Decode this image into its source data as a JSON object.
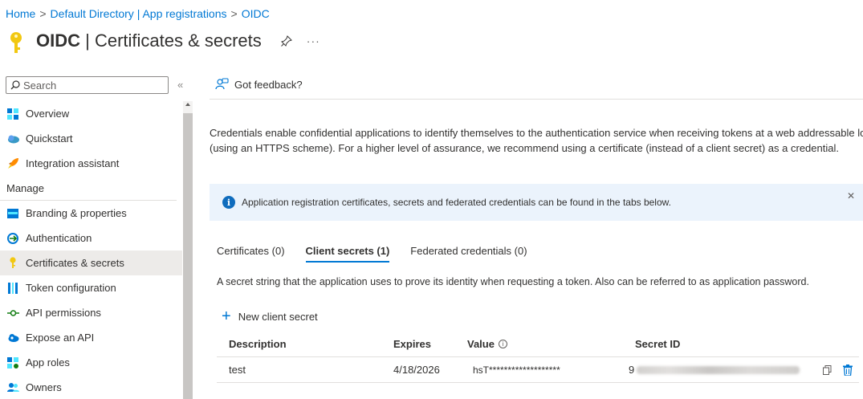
{
  "breadcrumb": {
    "items": [
      "Home",
      "Default Directory | App registrations",
      "OIDC"
    ],
    "separator": ">"
  },
  "page": {
    "title_bold": "OIDC",
    "title_rest": " | Certificates & secrets",
    "more": "···"
  },
  "search": {
    "placeholder": "Search"
  },
  "collapse_label": "«",
  "nav": {
    "items_top": [
      {
        "label": "Overview",
        "icon": "overview-icon"
      },
      {
        "label": "Quickstart",
        "icon": "quickstart-icon"
      },
      {
        "label": "Integration assistant",
        "icon": "rocket-icon"
      }
    ],
    "section": "Manage",
    "items_manage": [
      {
        "label": "Branding & properties",
        "icon": "branding-icon"
      },
      {
        "label": "Authentication",
        "icon": "authentication-icon"
      },
      {
        "label": "Certificates & secrets",
        "icon": "key-icon",
        "active": true
      },
      {
        "label": "Token configuration",
        "icon": "token-icon"
      },
      {
        "label": "API permissions",
        "icon": "api-permissions-icon"
      },
      {
        "label": "Expose an API",
        "icon": "cloud-icon"
      },
      {
        "label": "App roles",
        "icon": "app-roles-icon"
      },
      {
        "label": "Owners",
        "icon": "owners-icon"
      }
    ]
  },
  "feedback": {
    "label": "Got feedback?"
  },
  "description": {
    "line1": "Credentials enable confidential applications to identify themselves to the authentication service when receiving tokens at a web addressable location",
    "line2": "(using an HTTPS scheme). For a higher level of assurance, we recommend using a certificate (instead of a client secret) as a credential."
  },
  "infobar": {
    "text": "Application registration certificates, secrets and federated credentials can be found in the tabs below.",
    "close": "✕"
  },
  "tabs": [
    {
      "label": "Certificates (0)",
      "active": false
    },
    {
      "label": "Client secrets (1)",
      "active": true
    },
    {
      "label": "Federated credentials (0)",
      "active": false
    }
  ],
  "tab_description": "A secret string that the application uses to prove its identity when requesting a token. Also can be referred to as application password.",
  "new_secret": {
    "plus": "+",
    "label": "New client secret"
  },
  "table": {
    "headers": {
      "description": "Description",
      "expires": "Expires",
      "value": "Value",
      "secret_id": "Secret ID"
    },
    "rows": [
      {
        "description": "test",
        "expires": "4/18/2026",
        "value": "hsT*******************",
        "secret_id_prefix": "9"
      }
    ]
  },
  "colors": {
    "accent": "#0078d4",
    "key_yellow": "#f2c811",
    "info_bg": "#ebf3fc",
    "active_nav_bg": "#edebe9"
  }
}
